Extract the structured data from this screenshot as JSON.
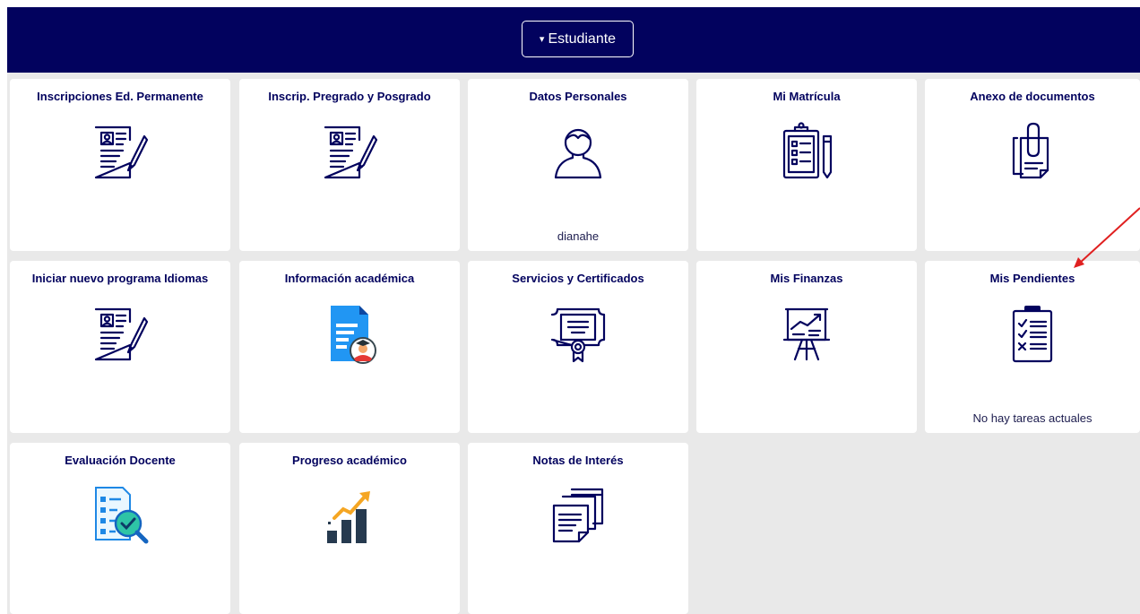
{
  "header": {
    "role_selector": {
      "caret": "▾",
      "label": "Estudiante"
    }
  },
  "tiles": [
    {
      "title": "Inscripciones Ed. Permanente",
      "icon": "enrollment-form-icon"
    },
    {
      "title": "Inscrip. Pregrado y Posgrado",
      "icon": "enrollment-form-icon"
    },
    {
      "title": "Datos Personales",
      "icon": "user-profile-icon",
      "footer": "dianahe"
    },
    {
      "title": "Mi Matrícula",
      "icon": "clipboard-pencil-icon"
    },
    {
      "title": "Anexo de documentos",
      "icon": "paperclip-documents-icon"
    },
    {
      "title": "Iniciar nuevo programa Idiomas",
      "icon": "enrollment-form-icon"
    },
    {
      "title": "Información académica",
      "icon": "academic-document-graduate-icon"
    },
    {
      "title": "Servicios y Certificados",
      "icon": "certificate-icon"
    },
    {
      "title": "Mis Finanzas",
      "icon": "presentation-chart-icon"
    },
    {
      "title": "Mis Pendientes",
      "icon": "checklist-icon",
      "footer": "No hay tareas actuales"
    },
    {
      "title": "Evaluación Docente",
      "icon": "document-magnifier-check-icon"
    },
    {
      "title": "Progreso académico",
      "icon": "growth-bar-chart-icon"
    },
    {
      "title": "Notas de Interés",
      "icon": "stacked-notes-icon"
    }
  ],
  "colors": {
    "header_bg": "#02025e",
    "tile_text": "#02025e",
    "grid_bg": "#e9e9e9",
    "annotation_arrow": "#e02020"
  }
}
